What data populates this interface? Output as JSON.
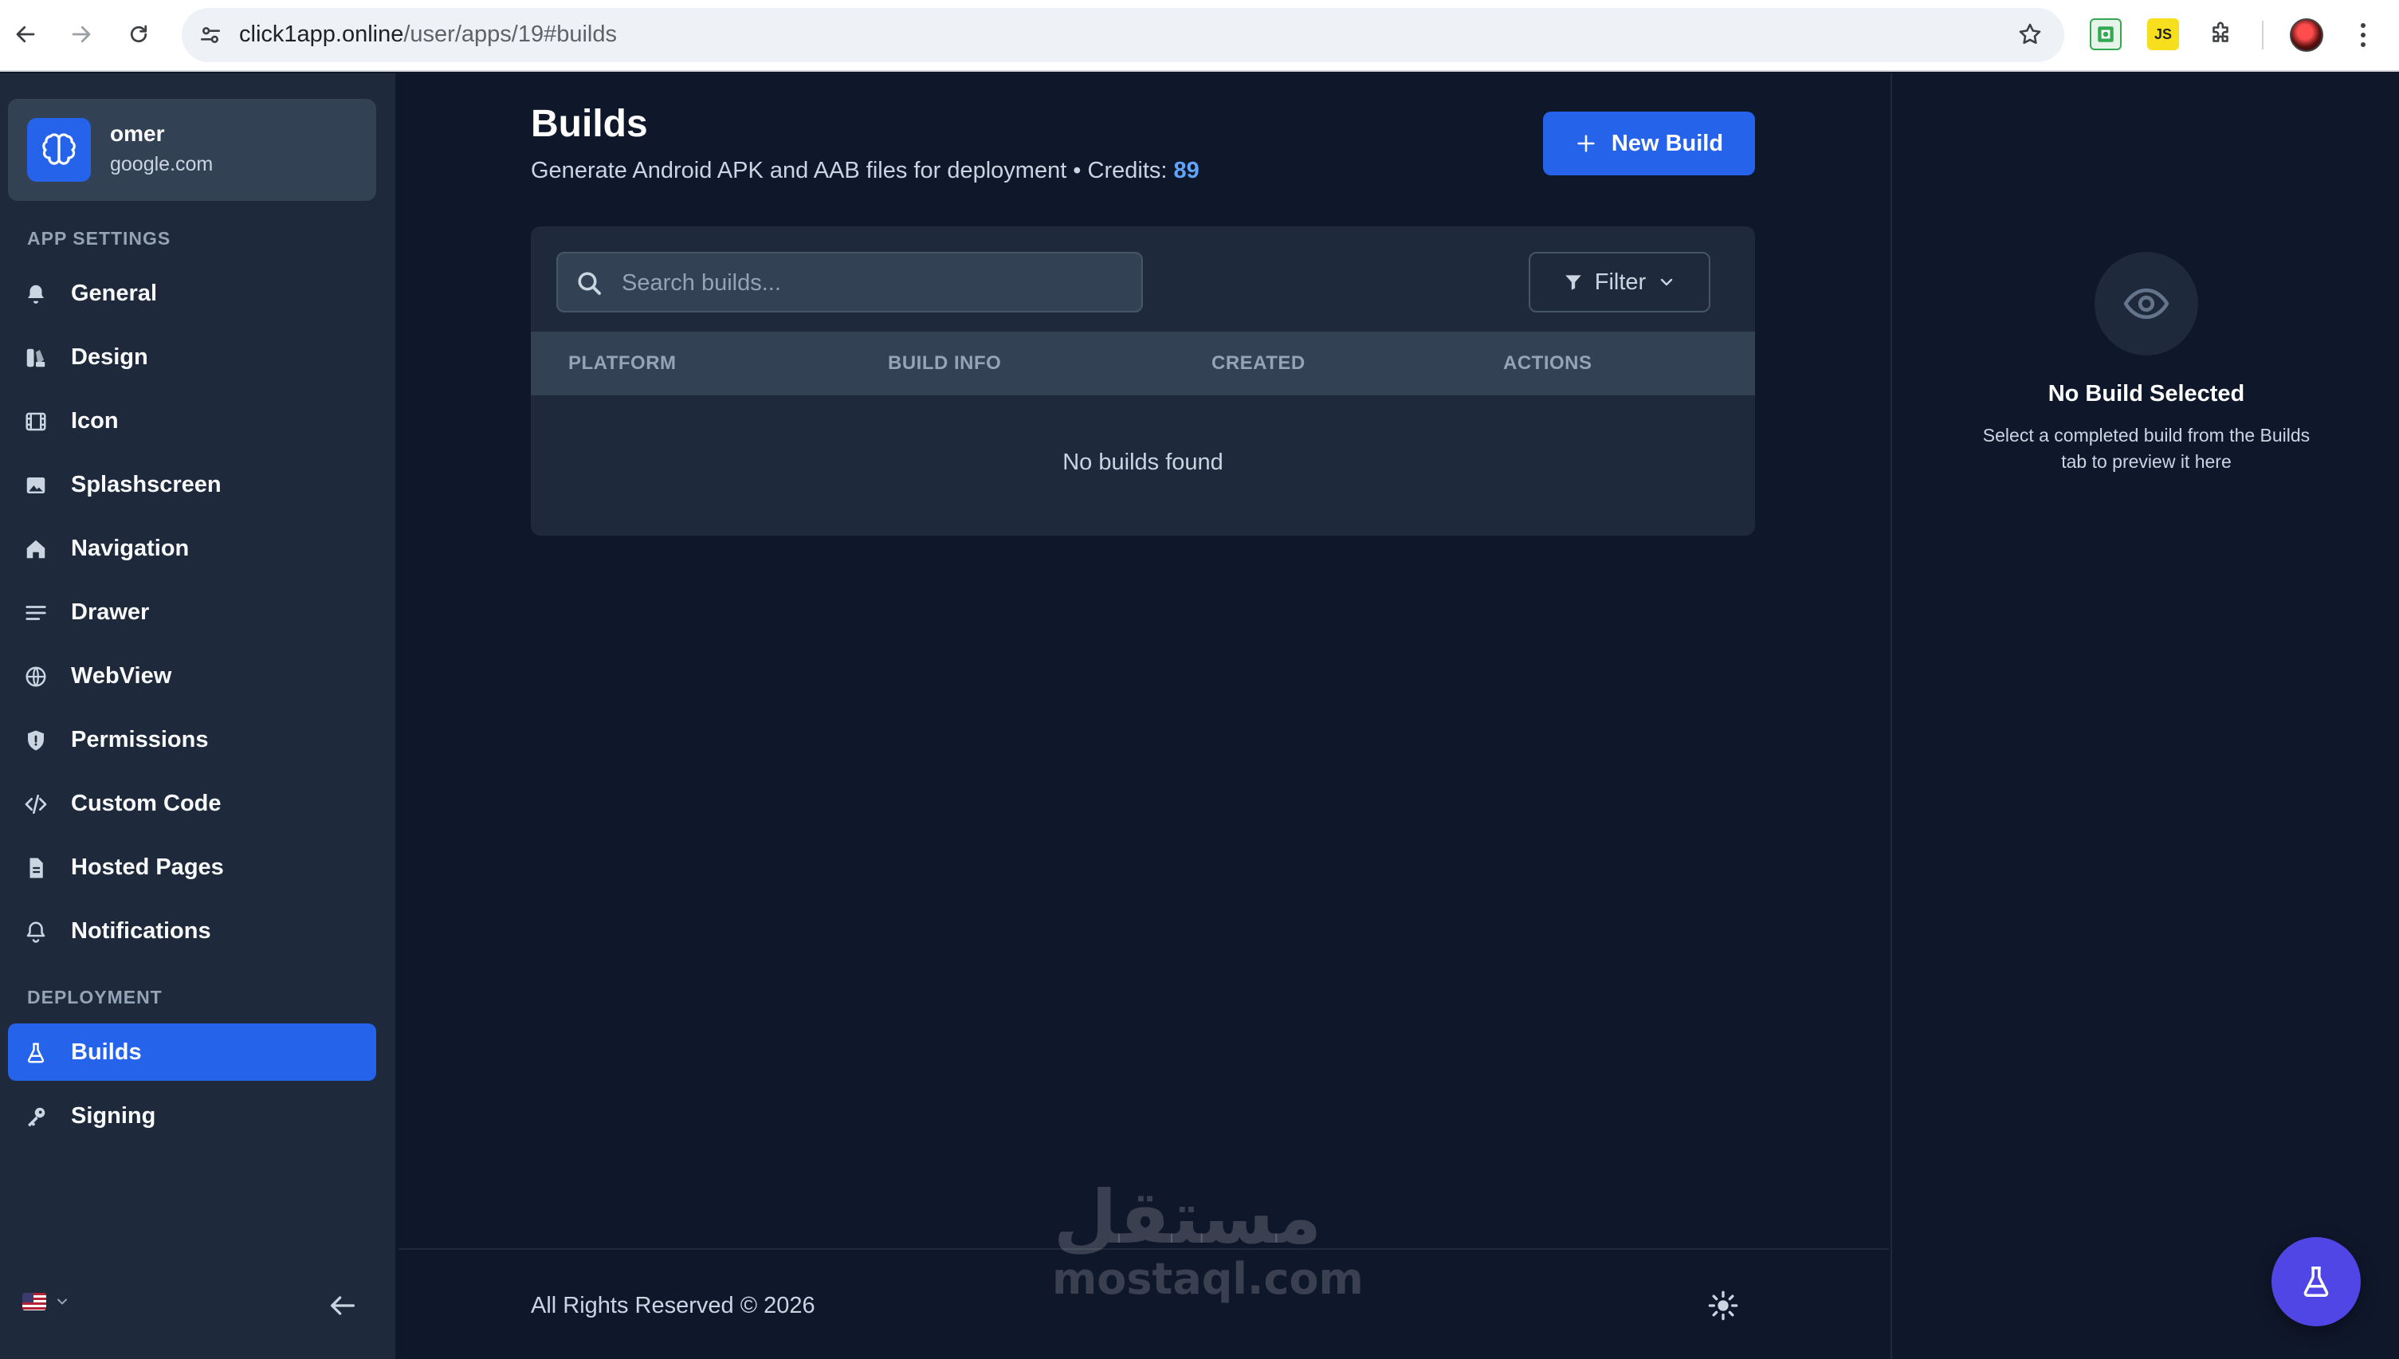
{
  "browser": {
    "url_host": "click1app.online",
    "url_path": "/user/apps/19#builds",
    "extensions": [
      "sheet-extension-icon",
      "js-extension-icon",
      "puzzle-icon"
    ],
    "ext_js_label": "JS"
  },
  "sidebar": {
    "app": {
      "name": "omer",
      "domain": "google.com"
    },
    "sections": {
      "app_settings": "APP SETTINGS",
      "deployment": "DEPLOYMENT"
    },
    "items": [
      {
        "label": "General",
        "icon": "bell-icon"
      },
      {
        "label": "Design",
        "icon": "palette-icon"
      },
      {
        "label": "Icon",
        "icon": "film-icon"
      },
      {
        "label": "Splashscreen",
        "icon": "image-icon"
      },
      {
        "label": "Navigation",
        "icon": "home-icon"
      },
      {
        "label": "Drawer",
        "icon": "menu-lines-icon"
      },
      {
        "label": "WebView",
        "icon": "globe-icon"
      },
      {
        "label": "Permissions",
        "icon": "shield-icon"
      },
      {
        "label": "Custom Code",
        "icon": "code-icon"
      },
      {
        "label": "Hosted Pages",
        "icon": "document-icon"
      },
      {
        "label": "Notifications",
        "icon": "bell-outline-icon"
      }
    ],
    "deploy_items": [
      {
        "label": "Builds",
        "icon": "flask-icon",
        "active": true
      },
      {
        "label": "Signing",
        "icon": "key-icon"
      }
    ]
  },
  "main": {
    "title": "Builds",
    "subtitle": "Generate Android APK and AAB files for deployment • Credits: ",
    "credits": "89",
    "new_build_label": "New Build",
    "search_placeholder": "Search builds...",
    "filter_label": "Filter",
    "columns": [
      "PLATFORM",
      "BUILD INFO",
      "CREATED",
      "ACTIONS"
    ],
    "empty_text": "No builds found",
    "footer": "All Rights Reserved © 2026"
  },
  "preview": {
    "title": "No Build Selected",
    "description": "Select a completed build from the Builds tab to preview it here"
  },
  "watermark": {
    "arabic": "مستقل",
    "latin": "mostaql.com"
  },
  "colors": {
    "accent": "#2563eb",
    "background": "#0f172a",
    "panel": "#1e293b",
    "fab": "#4f46e5",
    "credits": "#60a5fa"
  }
}
